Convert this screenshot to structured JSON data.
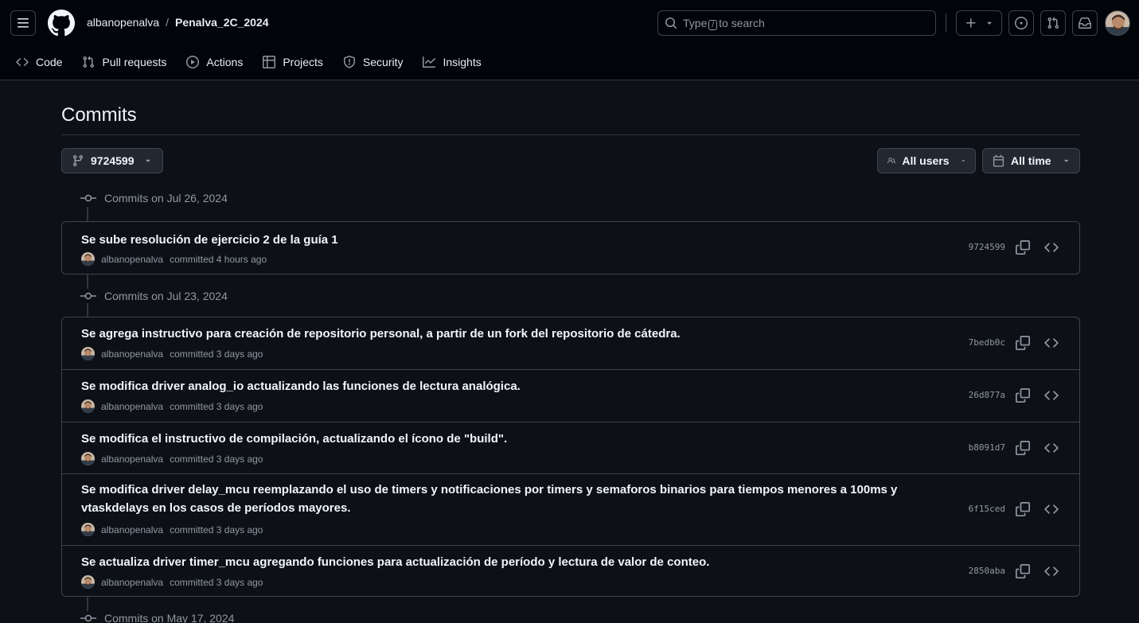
{
  "header": {
    "owner": "albanopenalva",
    "separator": "/",
    "repo": "Penalva_2C_2024",
    "search": {
      "before": "Type",
      "key": "/",
      "after": "to search"
    }
  },
  "tabs": [
    {
      "label": "Code",
      "icon": "code-icon"
    },
    {
      "label": "Pull requests",
      "icon": "pull-request-icon"
    },
    {
      "label": "Actions",
      "icon": "play-icon"
    },
    {
      "label": "Projects",
      "icon": "table-icon"
    },
    {
      "label": "Security",
      "icon": "shield-icon"
    },
    {
      "label": "Insights",
      "icon": "graph-icon"
    }
  ],
  "page": {
    "title": "Commits"
  },
  "filters": {
    "branch": "9724599",
    "users": "All users",
    "time": "All time"
  },
  "groups": [
    {
      "date_label": "Commits on Jul 26, 2024",
      "commits": [
        {
          "message": "Se sube resolución de ejercicio 2 de la guía 1",
          "author": "albanopenalva",
          "when": "committed 4 hours ago",
          "sha": "9724599"
        }
      ]
    },
    {
      "date_label": "Commits on Jul 23, 2024",
      "commits": [
        {
          "message": "Se agrega instructivo para creación de repositorio personal, a partir de un fork del repositorio de cátedra.",
          "author": "albanopenalva",
          "when": "committed 3 days ago",
          "sha": "7bedb0c"
        },
        {
          "message": "Se modifica driver analog_io actualizando las funciones de lectura analógica.",
          "author": "albanopenalva",
          "when": "committed 3 days ago",
          "sha": "26d877a"
        },
        {
          "message": "Se modifica el instructivo de compilación, actualizando el ícono de \"build\".",
          "author": "albanopenalva",
          "when": "committed 3 days ago",
          "sha": "b8091d7"
        },
        {
          "message": "Se modifica driver delay_mcu reemplazando el uso de timers y notificaciones por timers y semaforos binarios para tiempos menores a 100ms y vtaskdelays en los casos de períodos mayores.",
          "author": "albanopenalva",
          "when": "committed 3 days ago",
          "sha": "6f15ced"
        },
        {
          "message": "Se actualiza driver timer_mcu agregando funciones para actualización de período y lectura de valor de conteo.",
          "author": "albanopenalva",
          "when": "committed 3 days ago",
          "sha": "2850aba"
        }
      ]
    },
    {
      "date_label": "Commits on May 17, 2024",
      "commits": []
    }
  ]
}
